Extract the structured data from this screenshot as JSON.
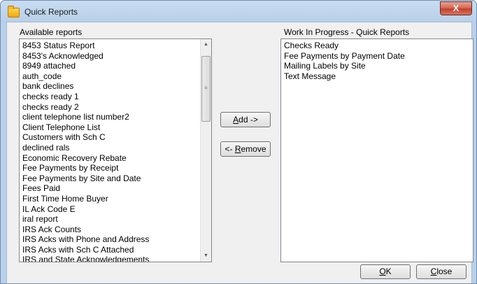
{
  "window": {
    "title": "Quick Reports",
    "close_glyph": "X"
  },
  "left_panel": {
    "label": "Available reports",
    "items": [
      "8453 Status Report",
      "8453's Acknowledged",
      "8949 attached",
      "auth_code",
      "bank declines",
      "checks ready 1",
      "checks ready 2",
      "client telephone list number2",
      "Client Telephone List",
      "Customers with Sch C",
      "declined rals",
      "Economic Recovery Rebate",
      "Fee Payments by Receipt",
      "Fee Payments by Site and Date",
      "Fees Paid",
      "First Time Home Buyer",
      "IL Ack Code E",
      "iral report",
      "IRS Ack Counts",
      "IRS Acks with Phone and Address",
      "IRS Acks with Sch C Attached",
      "IRS and State Acknowledgements"
    ]
  },
  "right_panel": {
    "label": "Work In Progress - Quick Reports",
    "items": [
      "Checks Ready",
      "Fee Payments by Payment Date",
      "Mailing Labels by Site",
      "Text Message"
    ]
  },
  "buttons": {
    "add": {
      "mnemonic": "A",
      "rest": "dd ->"
    },
    "remove": {
      "prefix": "<- ",
      "mnemonic": "R",
      "rest": "emove"
    },
    "ok": {
      "mnemonic": "O",
      "rest": "K"
    },
    "close": {
      "mnemonic": "C",
      "rest": "lose"
    }
  },
  "scrollbar": {
    "up_glyph": "▲",
    "down_glyph": "▼",
    "grip_glyph": "≡"
  }
}
